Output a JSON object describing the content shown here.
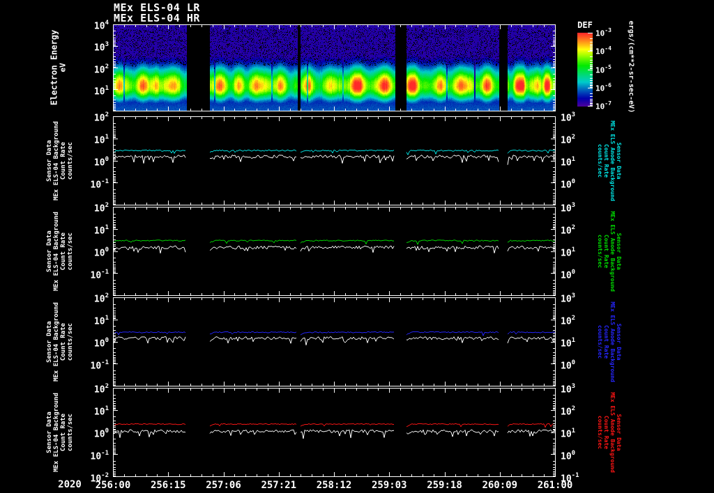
{
  "window": {
    "titles": {
      "lr": "MEx ELS-04 LR",
      "hr": "MEx ELS-04 HR"
    }
  },
  "x_axis": {
    "year": "2020",
    "tick_labels": [
      "256:00",
      "256:15",
      "257:06",
      "257:21",
      "258:12",
      "259:03",
      "259:18",
      "260:09",
      "261:00"
    ],
    "minor_per_major": 4
  },
  "chart_data": [
    {
      "type": "heatmap",
      "title": "MEx ELS-04 HR",
      "ylabel_lines": [
        "Electron Energy",
        "eV"
      ],
      "ytick_exponents": [
        4,
        3,
        2,
        1
      ],
      "y_range_exponents": [
        0,
        4
      ],
      "colorbar": {
        "title": "DEF",
        "units": "ergs/(cm**2-sr-sec-eV)",
        "tick_exponents": [
          -3,
          -4,
          -5,
          -6,
          -7
        ],
        "colors_top_to_bottom": [
          "#ff2929",
          "#ff8800",
          "#ffff00",
          "#00e000",
          "#00e0c0",
          "#0070ff",
          "#1818ff",
          "#5c00d8"
        ]
      },
      "energy_peak_log10_ev": 1.15,
      "background_level": 0.055,
      "segments": [
        [
          0,
          0.165
        ],
        [
          0.22,
          0.417
        ],
        [
          0.425,
          0.638
        ],
        [
          0.664,
          0.872
        ],
        [
          0.893,
          1.0
        ]
      ],
      "flares": [
        [
          {
            "p": 0.1,
            "a": 0.3,
            "w": 0.05
          },
          {
            "p": 0.42,
            "a": 0.4,
            "w": 0.07
          },
          {
            "p": 0.6,
            "a": 0.22,
            "w": 0.04
          },
          {
            "p": 0.82,
            "a": 0.32,
            "w": 0.06
          }
        ],
        [
          {
            "p": 0.1,
            "a": 0.32,
            "w": 0.05
          },
          {
            "p": 0.33,
            "a": 0.28,
            "w": 0.05
          },
          {
            "p": 0.55,
            "a": 0.3,
            "w": 0.06
          },
          {
            "p": 0.8,
            "a": 0.3,
            "w": 0.05
          }
        ],
        [
          {
            "p": 0.07,
            "a": 0.28,
            "w": 0.04
          },
          {
            "p": 0.33,
            "a": 0.3,
            "w": 0.05
          },
          {
            "p": 0.6,
            "a": 0.45,
            "w": 0.06
          },
          {
            "p": 0.88,
            "a": 0.52,
            "w": 0.05
          }
        ],
        [
          {
            "p": 0.07,
            "a": 0.48,
            "w": 0.05
          },
          {
            "p": 0.35,
            "a": 0.3,
            "w": 0.05
          },
          {
            "p": 0.62,
            "a": 0.36,
            "w": 0.06
          },
          {
            "p": 0.86,
            "a": 0.38,
            "w": 0.05
          }
        ],
        [
          {
            "p": 0.25,
            "a": 0.55,
            "w": 0.08
          },
          {
            "p": 0.6,
            "a": 0.3,
            "w": 0.05
          },
          {
            "p": 0.82,
            "a": 0.5,
            "w": 0.07
          }
        ]
      ],
      "dark_streaks": [
        {
          "x": 0.025,
          "d": 0.45
        },
        {
          "x": 0.23,
          "d": 0.5
        },
        {
          "x": 0.36,
          "d": 0.55
        },
        {
          "x": 0.44,
          "d": 0.5
        },
        {
          "x": 0.52,
          "d": 0.6
        },
        {
          "x": 0.755,
          "d": 0.5
        },
        {
          "x": 0.818,
          "d": 0.15
        }
      ],
      "seed": 7
    },
    {
      "type": "line",
      "ylim_left_exponents": [
        -2,
        2
      ],
      "ylim_right_exponents": [
        -1,
        3
      ],
      "bottom_extra_left_exponent": -2,
      "bottom_extra_right_exponent": -1,
      "segments": [
        [
          0,
          0.165
        ],
        [
          0.22,
          0.417
        ],
        [
          0.425,
          0.638
        ],
        [
          0.664,
          0.872
        ],
        [
          0.893,
          1.0
        ]
      ],
      "panels": [
        {
          "id": "panel-1",
          "color": "#00e6e6",
          "seed": 11,
          "left_label_lines": [
            "Sensor Data",
            "MEx ELS-04 Background",
            "Count Rate",
            "counts/sec"
          ],
          "right_label_lines": [
            "Sensor Data",
            "MEx ELS Anode Background",
            "Count Rate",
            "counts/sec"
          ],
          "left_tick_exponents": [
            2,
            1,
            0,
            -1
          ],
          "right_tick_exponents": [
            3,
            2,
            1,
            0
          ],
          "series": [
            {
              "name": "anode-background",
              "baseline_log10": 0.45,
              "noise": 0.03,
              "units": "counts/sec"
            },
            {
              "name": "els04-background",
              "baseline_log10": 0.18,
              "noise": 0.07,
              "units": "counts/sec"
            }
          ]
        },
        {
          "id": "panel-2",
          "color": "#00dd00",
          "seed": 22,
          "left_label_lines": [
            "Sensor Data",
            "MEx ELS-04 Background",
            "Count Rate",
            "counts/sec"
          ],
          "right_label_lines": [
            "Sensor Data",
            "MEx ELS Anode Background",
            "Count Rate",
            "counts/sec"
          ],
          "left_tick_exponents": [
            2,
            1,
            0,
            -1
          ],
          "right_tick_exponents": [
            3,
            2,
            1,
            0
          ],
          "series": [
            {
              "name": "anode-background",
              "baseline_log10": 0.47,
              "noise": 0.028,
              "units": "counts/sec"
            },
            {
              "name": "els04-background",
              "baseline_log10": 0.16,
              "noise": 0.075,
              "units": "counts/sec"
            }
          ]
        },
        {
          "id": "panel-3",
          "color": "#2626ff",
          "seed": 33,
          "left_label_lines": [
            "Sensor Data",
            "MEx ELS-04 Background",
            "Count Rate",
            "counts/sec"
          ],
          "right_label_lines": [
            "Sensor Data",
            "MEx ELS Anode Background",
            "Count Rate",
            "counts/sec"
          ],
          "left_tick_exponents": [
            2,
            1,
            0,
            -1
          ],
          "right_tick_exponents": [
            3,
            2,
            1,
            0
          ],
          "series": [
            {
              "name": "anode-background",
              "baseline_log10": 0.42,
              "noise": 0.028,
              "units": "counts/sec"
            },
            {
              "name": "els04-background",
              "baseline_log10": 0.15,
              "noise": 0.07,
              "units": "counts/sec"
            }
          ]
        },
        {
          "id": "panel-4",
          "color": "#ff1515",
          "seed": 44,
          "left_label_lines": [
            "Sensor Data",
            "MEx ELS-04 Background",
            "Count Rate",
            "counts/sec"
          ],
          "right_label_lines": [
            "Sensor Data",
            "MEx ELS Anode Background",
            "Count Rate",
            "counts/sec"
          ],
          "left_tick_exponents": [
            2,
            1,
            0,
            -1
          ],
          "right_tick_exponents": [
            3,
            2,
            1,
            0
          ],
          "series": [
            {
              "name": "anode-background",
              "baseline_log10": 0.36,
              "noise": 0.022,
              "units": "counts/sec"
            },
            {
              "name": "els04-background",
              "baseline_log10": 0.04,
              "noise": 0.065,
              "units": "counts/sec"
            }
          ]
        }
      ]
    }
  ]
}
